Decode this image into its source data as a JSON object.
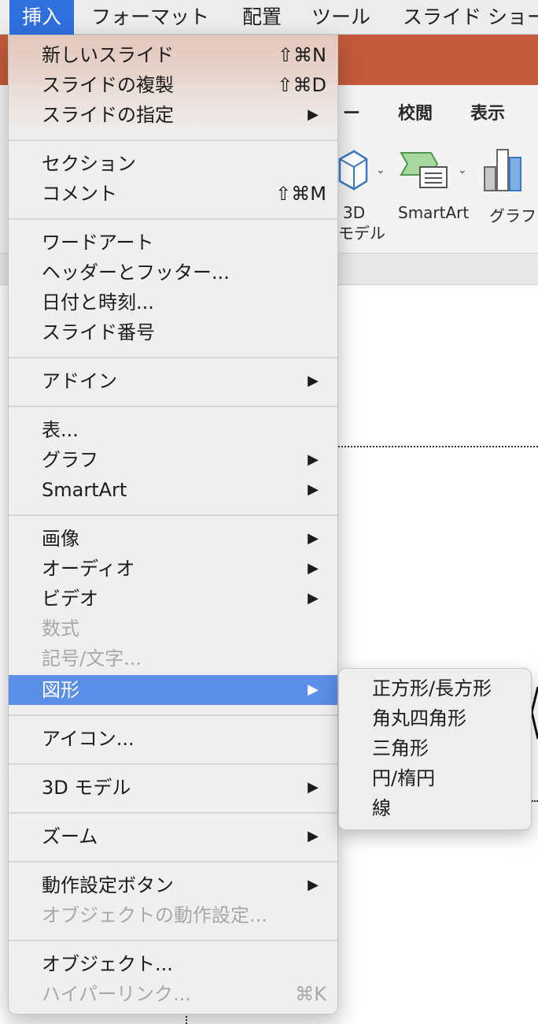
{
  "menubar": {
    "items": [
      {
        "label": "挿入",
        "active": true
      },
      {
        "label": "フォーマット"
      },
      {
        "label": "配置"
      },
      {
        "label": "ツール"
      },
      {
        "label": "スライド ショー"
      }
    ]
  },
  "app": {
    "ribbon_tabs": [
      "ー",
      "校閲",
      "表示"
    ],
    "ribbon_buttons": {
      "model3d_label_line1": "3D",
      "model3d_label_line2": "モデル",
      "smartart_label": "SmartArt",
      "graph_label": "グラフ"
    }
  },
  "menu": {
    "items": [
      {
        "label": "新しいスライド",
        "shortcut": "⇧⌘N"
      },
      {
        "label": "スライドの複製",
        "shortcut": "⇧⌘D"
      },
      {
        "label": "スライドの指定",
        "submenu": true
      },
      {
        "label": "セクション"
      },
      {
        "label": "コメント",
        "shortcut": "⇧⌘M"
      },
      {
        "label": "ワードアート"
      },
      {
        "label": "ヘッダーとフッター..."
      },
      {
        "label": "日付と時刻..."
      },
      {
        "label": "スライド番号"
      },
      {
        "label": "アドイン",
        "submenu": true
      },
      {
        "label": "表..."
      },
      {
        "label": "グラフ",
        "submenu": true
      },
      {
        "label": "SmartArt",
        "submenu": true
      },
      {
        "label": "画像",
        "submenu": true
      },
      {
        "label": "オーディオ",
        "submenu": true
      },
      {
        "label": "ビデオ",
        "submenu": true
      },
      {
        "label": "数式",
        "disabled": true
      },
      {
        "label": "記号/文字...",
        "disabled": true
      },
      {
        "label": "図形",
        "submenu": true,
        "highlighted": true
      },
      {
        "label": "アイコン..."
      },
      {
        "label": "3D モデル",
        "submenu": true
      },
      {
        "label": "ズーム",
        "submenu": true
      },
      {
        "label": "動作設定ボタン",
        "submenu": true
      },
      {
        "label": "オブジェクトの動作設定...",
        "disabled": true
      },
      {
        "label": "オブジェクト..."
      },
      {
        "label": "ハイパーリンク...",
        "shortcut": "⌘K",
        "disabled": true
      }
    ],
    "submenu_arrow": "▶"
  },
  "submenu": {
    "items": [
      {
        "label": "正方形/長方形"
      },
      {
        "label": "角丸四角形"
      },
      {
        "label": "三角形"
      },
      {
        "label": "円/楕円"
      },
      {
        "label": "線"
      }
    ]
  },
  "colors": {
    "menubar_active": "#2f6fde",
    "menu_highlight": "#5b8ee6",
    "titlebar": "#c45a3c",
    "disabled_text": "#a8a8a8"
  }
}
